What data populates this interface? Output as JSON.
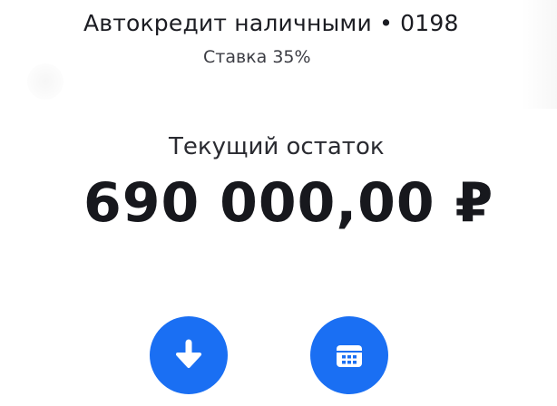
{
  "header": {
    "title": "Автокредит наличными • 0198",
    "rate": "Ставка 35%"
  },
  "balance": {
    "label": "Текущий остаток",
    "amount": "690 000,00 ₽"
  },
  "actions": {
    "deposit": {
      "icon": "arrow-down-icon"
    },
    "schedule": {
      "icon": "calendar-icon"
    }
  },
  "colors": {
    "accent": "#1a6ff3",
    "text": "#1b1c22"
  }
}
